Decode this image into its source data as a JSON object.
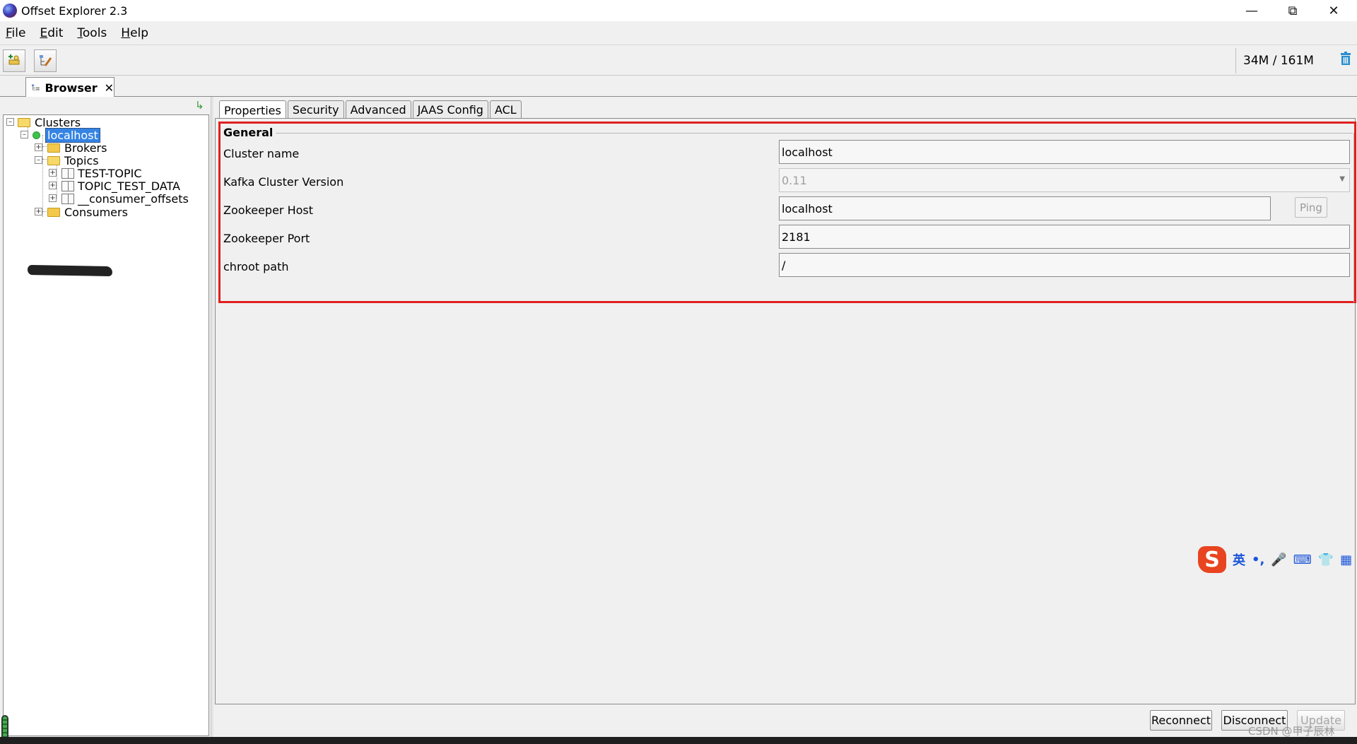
{
  "window": {
    "title": "Offset Explorer  2.3"
  },
  "menu": [
    {
      "mnemonic": "F",
      "rest": "ile"
    },
    {
      "mnemonic": "E",
      "rest": "dit"
    },
    {
      "mnemonic": "T",
      "rest": "ools"
    },
    {
      "mnemonic": "H",
      "rest": "elp"
    }
  ],
  "toolbar": {
    "memory": "34M / 161M"
  },
  "browser_tab": {
    "label": "Browser",
    "close": "✕"
  },
  "tree": {
    "root": "Clusters",
    "cluster": "localhost",
    "brokers": "Brokers",
    "topics": "Topics",
    "topic_items": [
      "TEST-TOPIC",
      "TOPIC_TEST_DATA",
      "__consumer_offsets"
    ],
    "consumers": "Consumers"
  },
  "tabs": [
    "Properties",
    "Security",
    "Advanced",
    "JAAS Config",
    "ACL"
  ],
  "general": {
    "legend": "General",
    "fields": [
      {
        "label": "Cluster name",
        "value": "localhost"
      },
      {
        "label": "Kafka Cluster Version",
        "value": "0.11"
      },
      {
        "label": "Zookeeper Host",
        "value": "localhost"
      },
      {
        "label": "Zookeeper Port",
        "value": "2181"
      },
      {
        "label": "chroot path",
        "value": "/"
      }
    ],
    "ping_label": "Ping"
  },
  "ime": {
    "logo": "S",
    "lang": "英",
    "punct": "•,",
    "mic": "🎤",
    "keyboard": "⌨",
    "skin": "👕",
    "grid": "▦"
  },
  "buttons": {
    "reconnect": "Reconnect",
    "disconnect": "Disconnect",
    "update": "Update"
  },
  "watermark": "CSDN @甲子辰林"
}
